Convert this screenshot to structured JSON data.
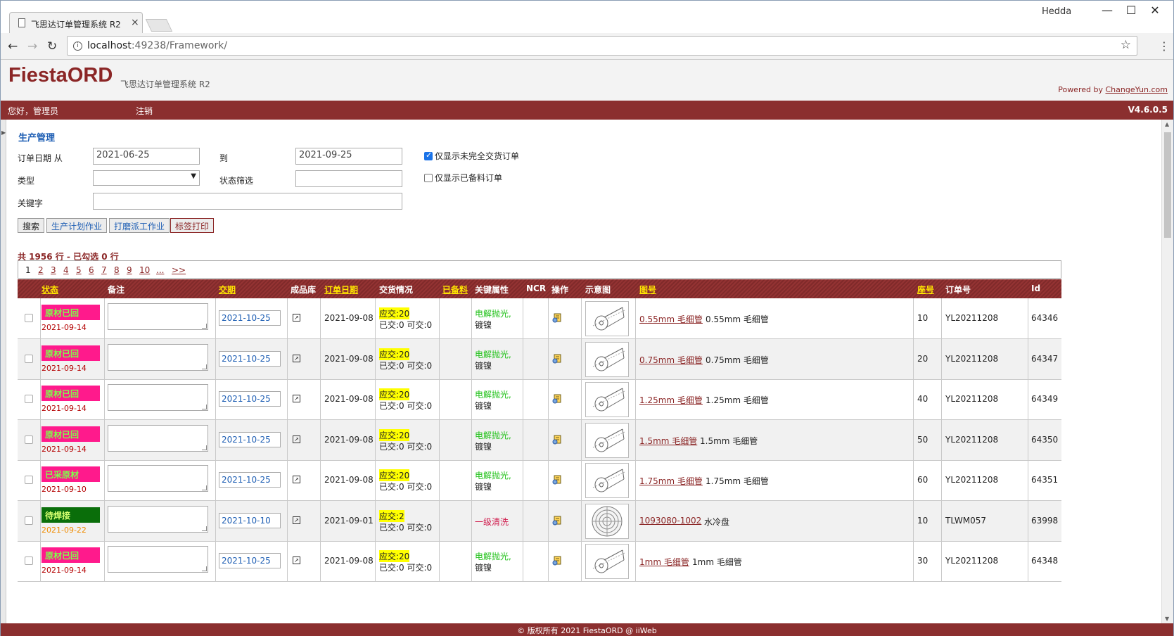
{
  "browser": {
    "tab_title": "飞思达订单管理系统 R2",
    "tab_close": "×",
    "user": "Hedda",
    "url_host": "localhost",
    "url_rest": ":49238/Framework/"
  },
  "app": {
    "logo": "FiestaORD",
    "subtitle": "飞思达订单管理系统 R2",
    "powered_prefix": "Powered by ",
    "powered_link": "ChangeYun.com",
    "greeting": "您好，管理员",
    "logout": "注销",
    "version": "V4.6.0.5"
  },
  "page": {
    "title": "生产管理",
    "date_from_label": "订单日期 从",
    "date_from": "2021-06-25",
    "date_to_label": "到",
    "date_to": "2021-09-25",
    "type_label": "类型",
    "status_label": "状态筛选",
    "keyword_label": "关键字",
    "chk_incomplete": "仅显示未完全交货订单",
    "chk_prepared": "仅显示已备料订单",
    "btn_search": "搜索",
    "btn_plan": "生产计划作业",
    "btn_grind": "打磨派工作业",
    "btn_label": "标签打印",
    "summary": "共 1956 行 - 已勾选 0 行"
  },
  "pager": {
    "current": "1",
    "pages": [
      "2",
      "3",
      "4",
      "5",
      "6",
      "7",
      "8",
      "9",
      "10",
      "...",
      ">>"
    ]
  },
  "columns": {
    "status": "状态",
    "remark": "备注",
    "due": "交期",
    "stock": "成品库",
    "order_date": "订单日期",
    "delivery": "交货情况",
    "prepared": "已备料",
    "attr": "关键属性",
    "ncr": "NCR",
    "op": "操作",
    "diagram": "示意图",
    "drawing": "图号",
    "seq": "座号",
    "order_no": "订单号",
    "id": "Id"
  },
  "rows": [
    {
      "status": "原材已回",
      "status_color": "#ff1a8c",
      "status_date": "2021-09-14",
      "due": "2021-10-25",
      "order_date": "2021-09-08",
      "d1": "应交:20",
      "d2": "已交:0 可交:0",
      "attr1": "电解抛光,",
      "attr2": "镀镍",
      "drawing_no": "0.55mm 毛细管",
      "drawing_name": "0.55mm 毛细管",
      "seq": "10",
      "order_no": "YL20211208",
      "id": "64346",
      "kind": "tube"
    },
    {
      "status": "原材已回",
      "status_color": "#ff1a8c",
      "status_date": "2021-09-14",
      "due": "2021-10-25",
      "order_date": "2021-09-08",
      "d1": "应交:20",
      "d2": "已交:0 可交:0",
      "attr1": "电解抛光,",
      "attr2": "镀镍",
      "drawing_no": "0.75mm 毛细管",
      "drawing_name": "0.75mm 毛细管",
      "seq": "20",
      "order_no": "YL20211208",
      "id": "64347",
      "kind": "tube"
    },
    {
      "status": "原材已回",
      "status_color": "#ff1a8c",
      "status_date": "2021-09-14",
      "due": "2021-10-25",
      "order_date": "2021-09-08",
      "d1": "应交:20",
      "d2": "已交:0 可交:0",
      "attr1": "电解抛光,",
      "attr2": "镀镍",
      "drawing_no": "1.25mm 毛细管",
      "drawing_name": "1.25mm 毛细管",
      "seq": "40",
      "order_no": "YL20211208",
      "id": "64349",
      "kind": "tube"
    },
    {
      "status": "原材已回",
      "status_color": "#ff1a8c",
      "status_date": "2021-09-14",
      "due": "2021-10-25",
      "order_date": "2021-09-08",
      "d1": "应交:20",
      "d2": "已交:0 可交:0",
      "attr1": "电解抛光,",
      "attr2": "镀镍",
      "drawing_no": "1.5mm 毛细管",
      "drawing_name": "1.5mm 毛细管",
      "seq": "50",
      "order_no": "YL20211208",
      "id": "64350",
      "kind": "tube"
    },
    {
      "status": "已采原材",
      "status_color": "#ff1a8c",
      "status_date": "2021-09-10",
      "due": "2021-10-25",
      "order_date": "2021-09-08",
      "d1": "应交:20",
      "d2": "已交:0 可交:0",
      "attr1": "电解抛光,",
      "attr2": "镀镍",
      "drawing_no": "1.75mm 毛细管",
      "drawing_name": "1.75mm 毛细管",
      "seq": "60",
      "order_no": "YL20211208",
      "id": "64351",
      "kind": "tube"
    },
    {
      "status": "待焊接",
      "status_color": "#0a6e0a",
      "status_date": "2021-09-22",
      "due": "2021-10-10",
      "order_date": "2021-09-01",
      "d1": "应交:2",
      "d2": "已交:0 可交:0",
      "attr1": "一级清洗",
      "attr2": "",
      "drawing_no": "1093080-1002",
      "drawing_name": "水冷盘",
      "seq": "10",
      "order_no": "TLWM057",
      "id": "63998",
      "kind": "plate"
    },
    {
      "status": "原材已回",
      "status_color": "#ff1a8c",
      "status_date": "2021-09-14",
      "due": "2021-10-25",
      "order_date": "2021-09-08",
      "d1": "应交:20",
      "d2": "已交:0 可交:0",
      "attr1": "电解抛光,",
      "attr2": "镀镍",
      "drawing_no": "1mm 毛细管",
      "drawing_name": "1mm 毛细管",
      "seq": "30",
      "order_no": "YL20211208",
      "id": "64348",
      "kind": "tube"
    }
  ],
  "footer": "© 版权所有 2021 FiestaORD @ iiWeb"
}
